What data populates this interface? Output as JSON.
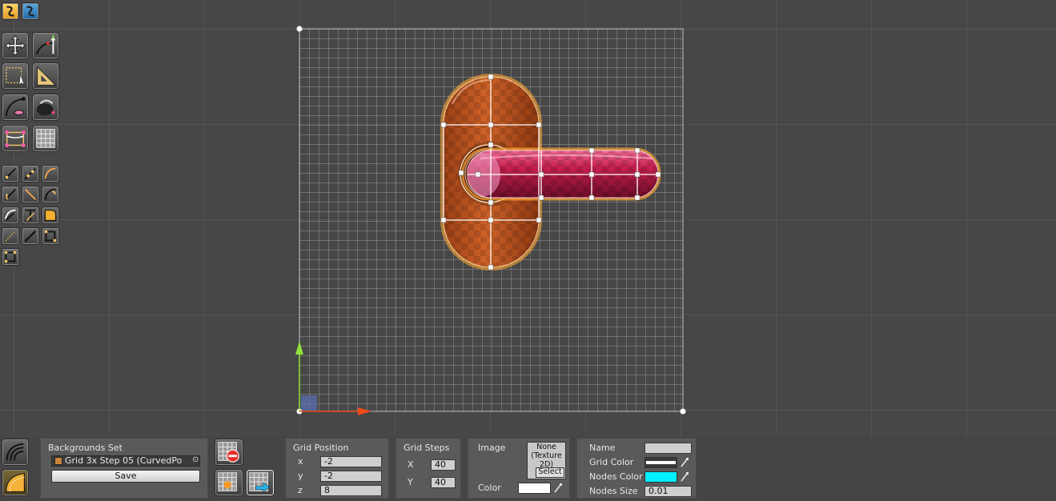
{
  "toolbar_top": [
    {
      "icon": "curve-editor-icon",
      "active": true
    },
    {
      "icon": "shape-editor-icon",
      "active": false
    }
  ],
  "tools": [
    {
      "icon": "move-icon"
    },
    {
      "icon": "curve-normal-icon"
    },
    {
      "icon": "rect-select-icon"
    },
    {
      "icon": "ruler-triangle-icon"
    },
    {
      "icon": "bezier-curve-icon"
    },
    {
      "icon": "pen-bucket-icon"
    },
    {
      "icon": "bounds-icon"
    },
    {
      "icon": "grid-icon"
    }
  ],
  "small_tools": [
    {
      "icon": "node-tool-1-icon"
    },
    {
      "icon": "node-tool-2-icon"
    },
    {
      "icon": "node-tool-3-icon"
    },
    {
      "icon": "node-tool-4-icon"
    },
    {
      "icon": "node-tool-5-icon"
    },
    {
      "icon": "node-tool-6-icon"
    },
    {
      "icon": "node-tool-7-icon"
    },
    {
      "icon": "node-tool-8-icon"
    },
    {
      "icon": "node-tool-9-icon"
    },
    {
      "icon": "node-tool-10-icon"
    },
    {
      "icon": "node-tool-11-icon"
    },
    {
      "icon": "node-tool-12-icon"
    },
    {
      "icon": "node-tool-13-icon"
    }
  ],
  "colors": {
    "grid": "#ffffff",
    "nodes": "#00f0ff",
    "backplate": "#c4571e",
    "handle": "#c8204f",
    "accent": "#ff9a2a"
  },
  "backgrounds": {
    "title": "Backgrounds Set",
    "selected": "Grid 3x Step 05 (CurvedPo",
    "save_label": "Save"
  },
  "grid_position": {
    "title": "Grid Position",
    "x_label": "x",
    "x": "-2",
    "y_label": "y",
    "y": "-2",
    "z_label": "z",
    "z": "8"
  },
  "grid_steps": {
    "title": "Grid Steps",
    "x_label": "X",
    "x": "40",
    "y_label": "Y",
    "y": "40"
  },
  "image": {
    "title": "Image",
    "texture_line1": "None",
    "texture_line2": "(Texture",
    "texture_line3": "2D)",
    "select_label": "Select",
    "color_label": "Color"
  },
  "props": {
    "name_label": "Name",
    "name": "",
    "grid_color_label": "Grid Color",
    "nodes_color_label": "Nodes Color",
    "nodes_size_label": "Nodes Size",
    "nodes_size": "0.01"
  }
}
